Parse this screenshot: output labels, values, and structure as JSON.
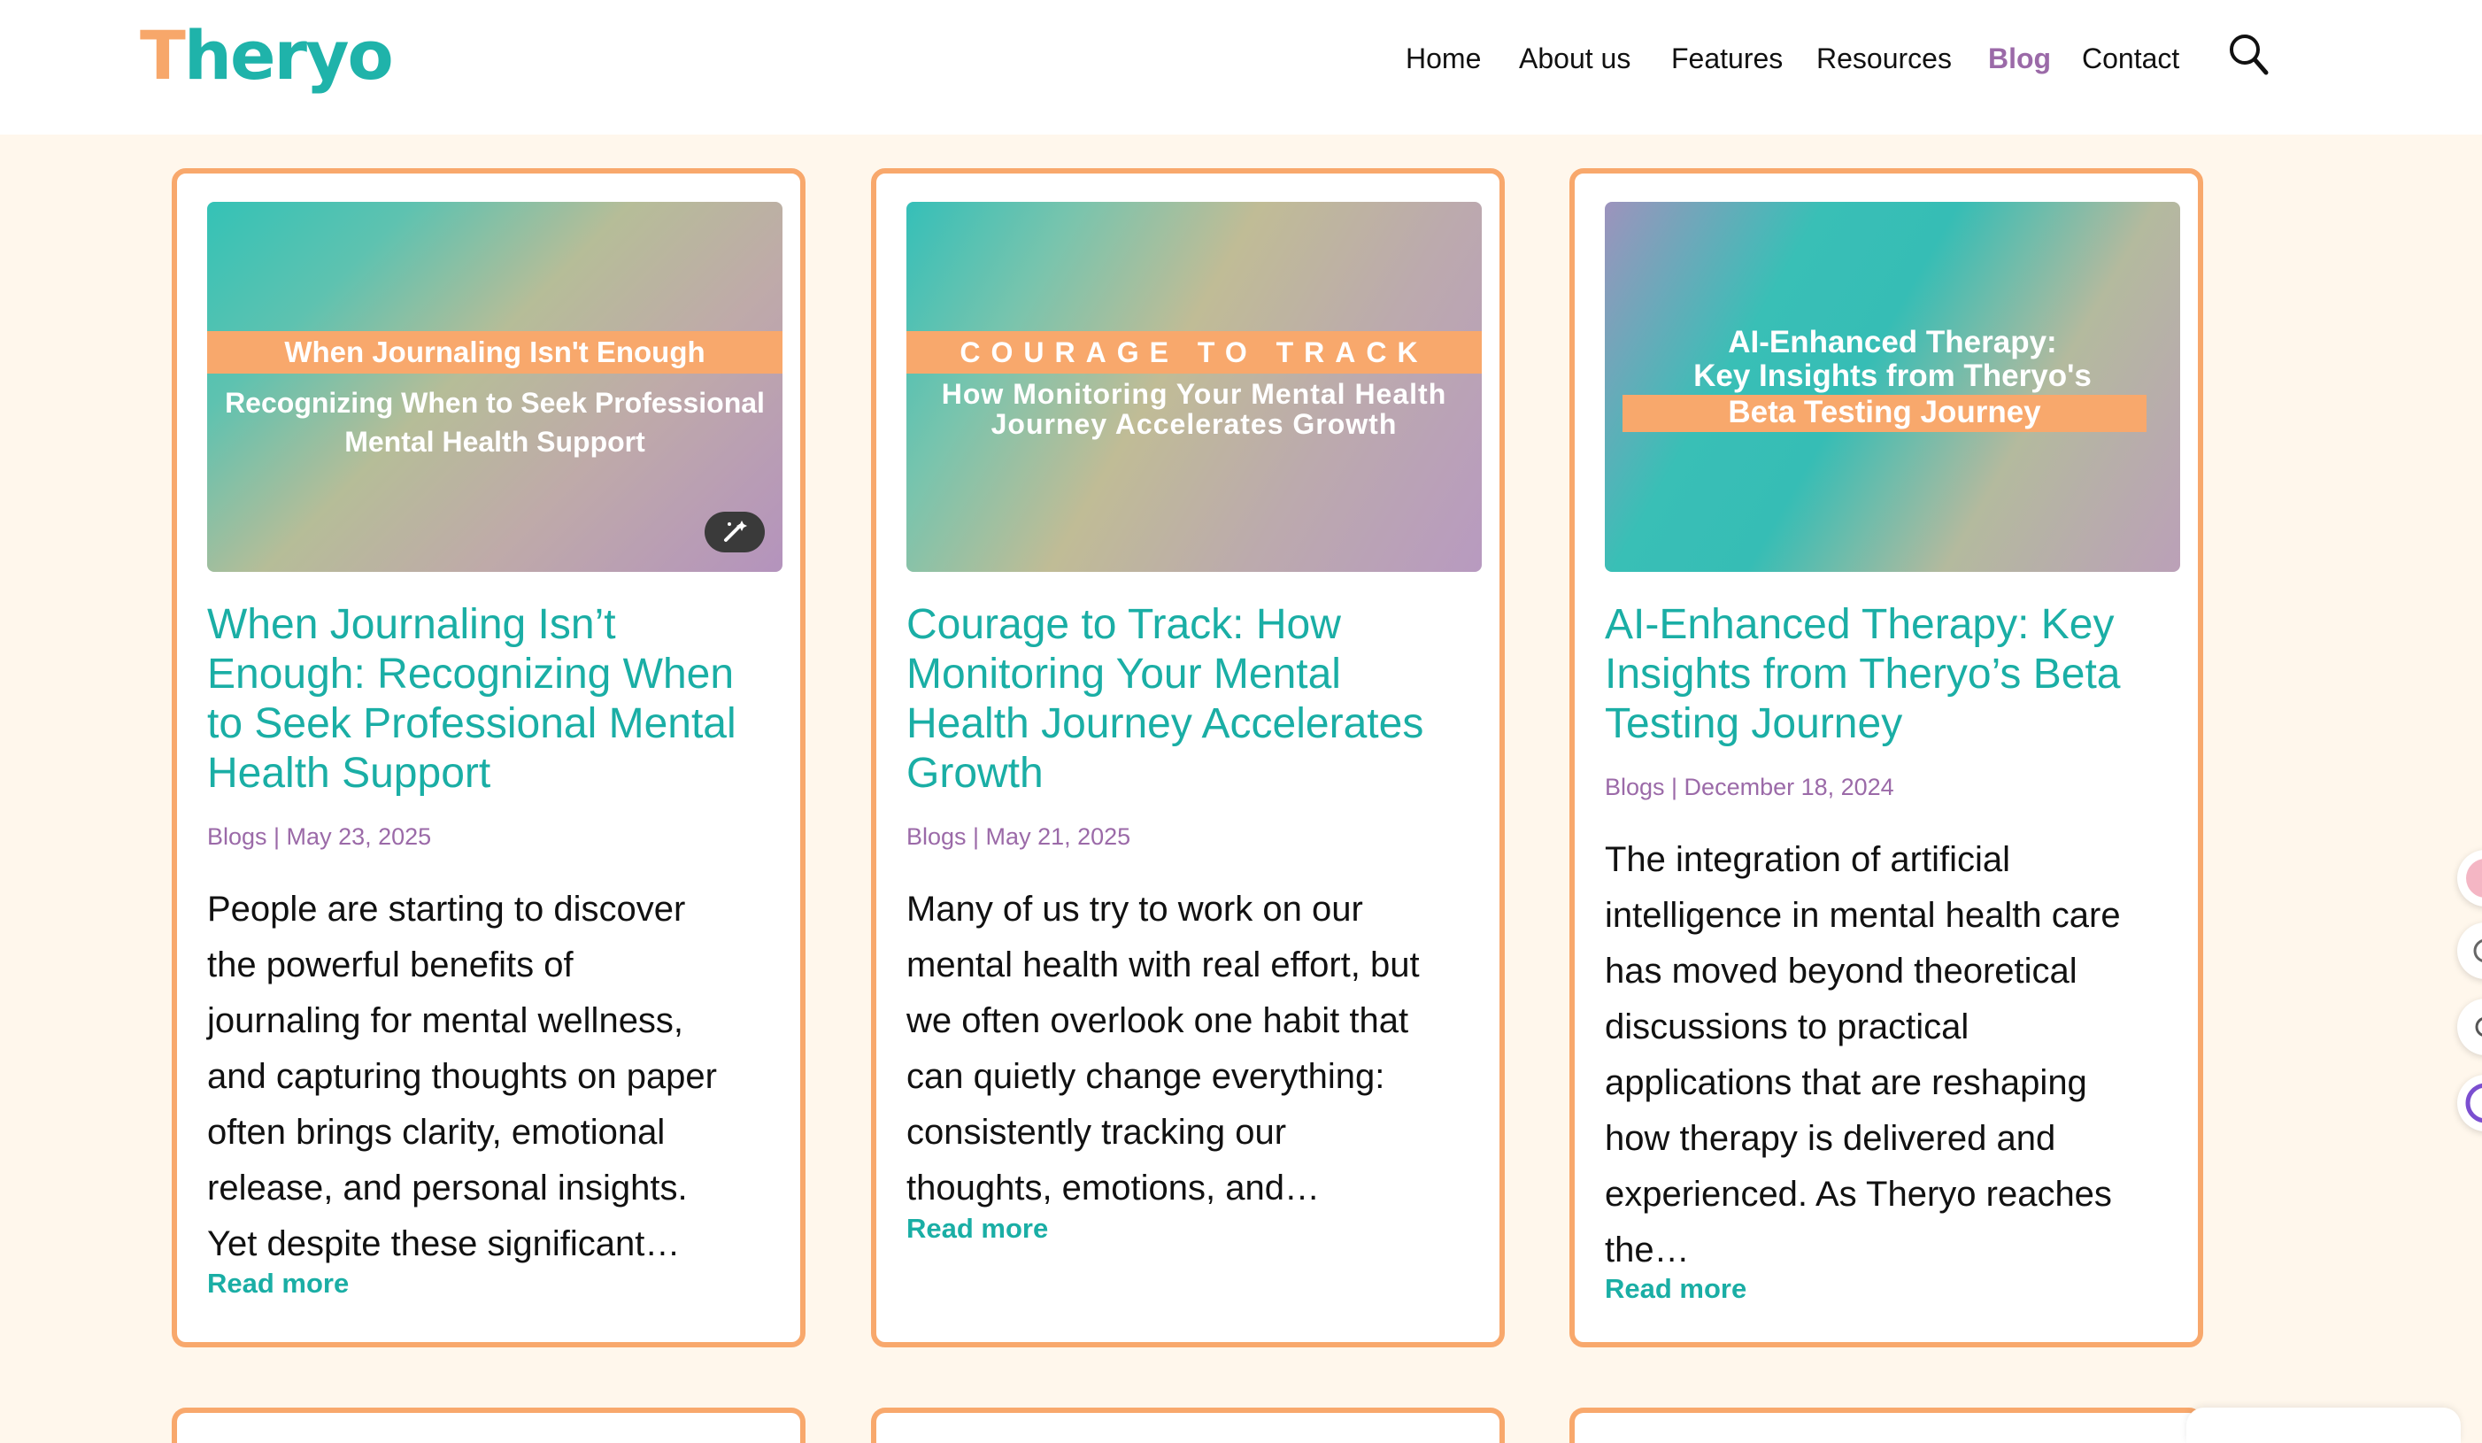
{
  "brand": {
    "logo_first": "T",
    "logo_rest": "heryo"
  },
  "nav": {
    "items": [
      {
        "label": "Home"
      },
      {
        "label": "About us"
      },
      {
        "label": "Features"
      },
      {
        "label": "Resources"
      },
      {
        "label": "Blog",
        "active": true
      },
      {
        "label": "Contact"
      }
    ]
  },
  "colors": {
    "teal": "#1aaea5",
    "orange": "#f8a86c",
    "purple": "#9b6aa8",
    "page_bg": "#fff7ec"
  },
  "cards": [
    {
      "thumb_band": "When Journaling Isn't Enough",
      "thumb_sub_1": "Recognizing When to Seek Professional",
      "thumb_sub_2": "Mental Health Support",
      "title_lines": [
        "When Journaling Isn’t",
        "Enough: Recognizing When",
        "to Seek Professional Mental",
        "Health Support"
      ],
      "meta": "Blogs | May 23, 2025",
      "excerpt_lines": [
        "People are starting to discover",
        "the powerful benefits of",
        "journaling for mental wellness,",
        "and capturing thoughts on paper",
        "often brings clarity, emotional",
        "release, and personal insights.",
        "Yet despite these significant…"
      ],
      "read_more": "Read more"
    },
    {
      "thumb_band": "COURAGE TO TRACK",
      "thumb_sub_1": "How Monitoring Your Mental Health",
      "thumb_sub_2": "Journey Accelerates Growth",
      "title_lines": [
        "Courage to Track: How",
        "Monitoring Your Mental",
        "Health Journey Accelerates",
        "Growth"
      ],
      "meta": "Blogs | May 21, 2025",
      "excerpt_lines": [
        "Many of us try to work on our",
        "mental health with real effort, but",
        "we often overlook one habit that",
        "can quietly change everything:",
        "consistently tracking our",
        "thoughts, emotions, and…"
      ],
      "read_more": "Read more"
    },
    {
      "thumb_line_1": "AI-Enhanced Therapy:",
      "thumb_line_2": "Key Insights from Theryo's",
      "thumb_band": "Beta Testing Journey",
      "title_lines": [
        "AI-Enhanced Therapy: Key",
        "Insights from Theryo’s Beta",
        "Testing Journey"
      ],
      "meta": "Blogs | December 18, 2024",
      "excerpt_lines": [
        "The integration of artificial",
        "intelligence in mental health care",
        "has moved beyond theoretical",
        "discussions to practical",
        "applications that are reshaping",
        "how therapy is delivered and",
        "experienced. As Theryo reaches",
        "the…"
      ],
      "read_more": "Read more"
    }
  ]
}
